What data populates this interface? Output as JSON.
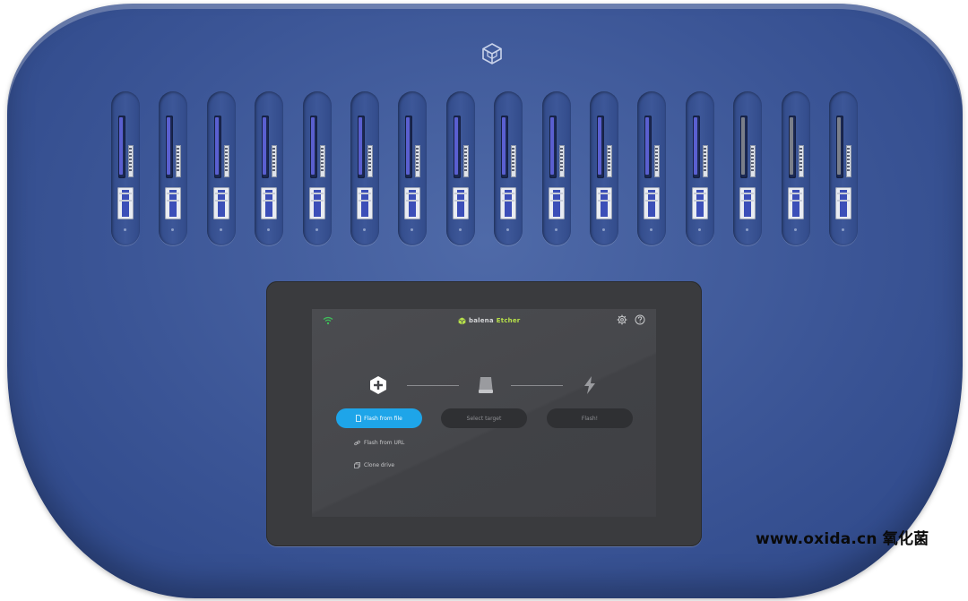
{
  "app": {
    "brand_name": "balena",
    "brand_product": "Etcher"
  },
  "device": {
    "port_count": 16,
    "colors": {
      "body": "#3b5596",
      "bezel": "#3a3b3e",
      "screen": "#4b4c50",
      "accent": "#1ea5e9",
      "brand_green": "#b7e04a"
    }
  },
  "header": {
    "wifi_icon": "wifi-icon",
    "settings_icon": "gear-icon",
    "help_icon": "help-circle-icon"
  },
  "steps": [
    {
      "icon": "plus-hexagon-icon",
      "button_label": "Flash from file",
      "button_icon": "file-icon",
      "active": true
    },
    {
      "icon": "drive-icon",
      "button_label": "Select target",
      "active": false
    },
    {
      "icon": "flash-bolt-icon",
      "button_label": "Flash!",
      "active": false
    }
  ],
  "alt_actions": [
    {
      "label": "Flash from URL",
      "icon": "link-icon"
    },
    {
      "label": "Clone drive",
      "icon": "copy-icon"
    }
  ],
  "watermark": "www.oxida.cn 氧化菌"
}
